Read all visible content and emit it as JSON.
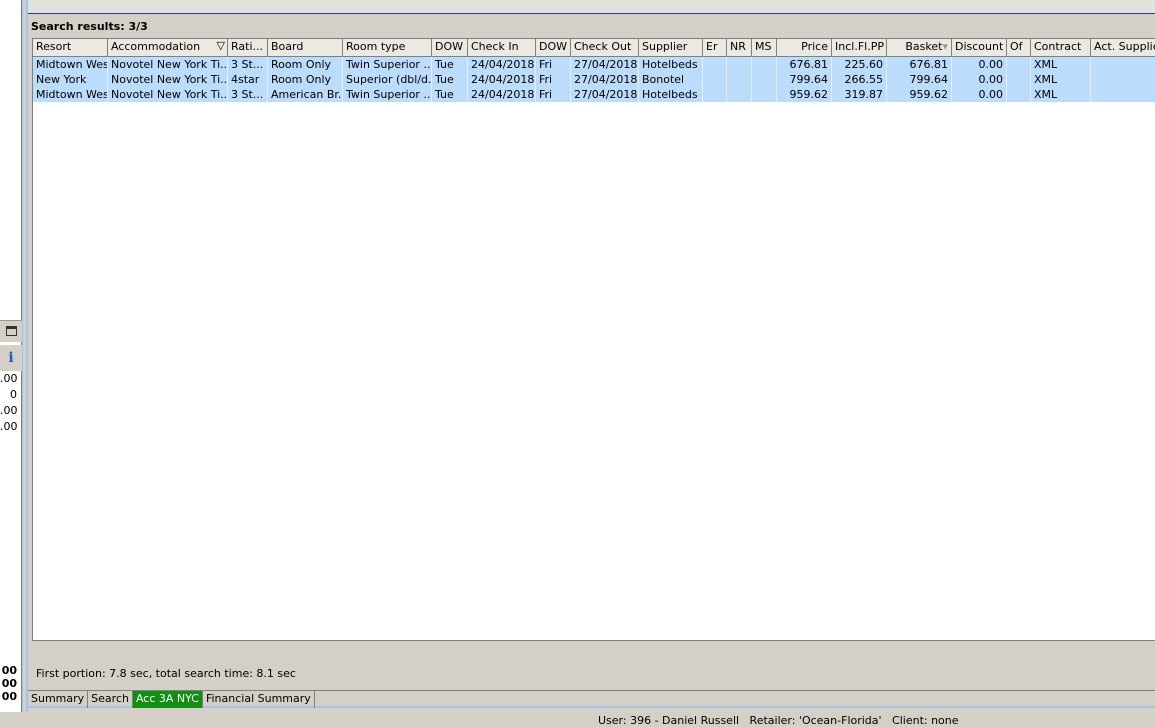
{
  "search_title": "Search results: 3/3",
  "left_values": [
    ".00",
    "0",
    ".00",
    ".00"
  ],
  "left_bottom_values": [
    "00",
    "00",
    "00"
  ],
  "columns": [
    "Resort",
    "Accommodation",
    "Rati...",
    "Board",
    "Room type",
    "DOW",
    "Check In",
    "DOW",
    "Check Out",
    "Supplier",
    "Er",
    "NR",
    "MS",
    "Price",
    "Incl.Fl.PP",
    "Basket",
    "Discount",
    "Of",
    "Contract",
    "Act. Supplier"
  ],
  "rows": [
    [
      "Midtown West",
      "Novotel New York Ti...",
      "3 St...",
      "Room Only",
      "Twin Superior ...",
      "Tue",
      "24/04/2018",
      "Fri",
      "27/04/2018",
      "Hotelbeds",
      "",
      "",
      "",
      "676.81",
      "225.60",
      "676.81",
      "0.00",
      "",
      "XML",
      ""
    ],
    [
      "New York",
      "Novotel New York Ti...",
      "4star",
      "Room Only",
      "Superior (dbl/d...",
      "Tue",
      "24/04/2018",
      "Fri",
      "27/04/2018",
      "Bonotel",
      "",
      "",
      "",
      "799.64",
      "266.55",
      "799.64",
      "0.00",
      "",
      "XML",
      ""
    ],
    [
      "Midtown West",
      "Novotel New York Ti...",
      "3 St...",
      "American Br...",
      "Twin Superior ...",
      "Tue",
      "24/04/2018",
      "Fri",
      "27/04/2018",
      "Hotelbeds",
      "",
      "",
      "",
      "959.62",
      "319.87",
      "959.62",
      "0.00",
      "",
      "XML",
      ""
    ]
  ],
  "timing": "First portion: 7.8 sec, total search time: 8.1 sec",
  "tabs": [
    "Summary",
    "Search",
    "Acc 3A NYC",
    "Financial Summary"
  ],
  "active_tab": 2,
  "status": "User: 396 - Daniel Russell   Retailer: 'Ocean-Florida'   Client: none"
}
